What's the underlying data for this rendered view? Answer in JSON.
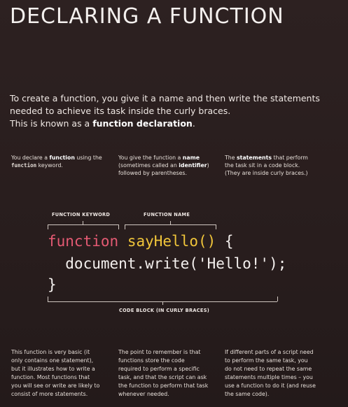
{
  "title": "DECLARING A FUNCTION",
  "intro": {
    "line1": "To create a function, you give it a name and then write the statements",
    "line2": "needed to achieve its task inside the curly braces.",
    "line3_prefix": "This is known as a ",
    "line3_bold": "function declaration",
    "line3_suffix": "."
  },
  "notes": {
    "keyword": {
      "pre": "You declare a ",
      "bold": "function",
      "mid": " using the",
      "code": "function",
      "post": " keyword."
    },
    "name": {
      "pre": "You give the function a ",
      "bold": "name",
      "mid": "(sometimes called an ",
      "bold2": "identifier",
      "post": ")",
      "line3": "followed by parentheses."
    },
    "statements": {
      "pre": "The ",
      "bold": "statements",
      "post": " that perform",
      "line2": "the task sit in a code block.",
      "line3": "(They are inside curly braces.)"
    }
  },
  "captions": {
    "keyword": "FUNCTION KEYWORD",
    "name": "FUNCTION NAME",
    "block": "CODE BLOCK (IN CURLY BRACES)"
  },
  "code": {
    "keyword": "function",
    "name": "sayHello()",
    "open_brace": " {",
    "body": "  document.write('Hello!');",
    "close_brace": "}"
  },
  "footer": {
    "col1": [
      "This function is very basic (it",
      "only contains one statement),",
      "but it illustrates how to write a",
      "function. Most functions that",
      "you will see or write are likely to",
      "consist of more statements."
    ],
    "col2": [
      "The point to remember is that",
      "functions store the code",
      "required to perform a specific",
      "task, and that the script can ask",
      "the function to perform that task",
      "whenever needed."
    ],
    "col3": [
      "If different parts of a script need",
      "to perform the same task, you",
      "do not need to repeat the same",
      "statements multiple times – you",
      "use a function to do it (and reuse",
      "the same code)."
    ]
  }
}
